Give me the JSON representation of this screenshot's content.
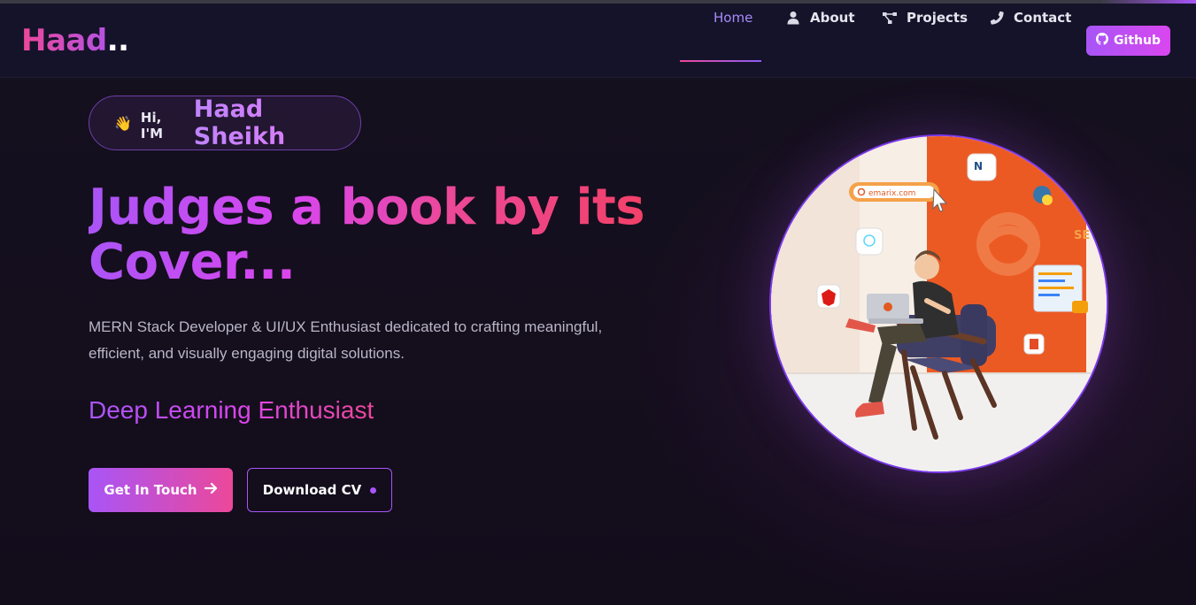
{
  "brand": {
    "name": "Haad",
    "dots": ".."
  },
  "nav": {
    "items": [
      {
        "label": "Home",
        "icon": "none",
        "active": true
      },
      {
        "label": "About",
        "icon": "user-icon"
      },
      {
        "label": "Projects",
        "icon": "project-icon"
      },
      {
        "label": "Contact",
        "icon": "phone-icon"
      }
    ],
    "github": {
      "label": "Github",
      "icon": "github-icon"
    }
  },
  "hero": {
    "greeting_wave": "👋",
    "greeting_prefix": "Hi, I'M",
    "name": "Haad Sheikh",
    "headline_line1": "Judges a book by its",
    "headline_line2": "Cover...",
    "description": "MERN Stack Developer & UI/UX Enthusiast dedicated to crafting meaningful, efficient, and visually engaging digital solutions.",
    "subtitle": "Deep Learning Enthusiast",
    "primary_button": "Get In Touch",
    "secondary_button": "Download CV"
  },
  "illustration": {
    "search_text": "emarix.com",
    "badge_se": "SE"
  },
  "colors": {
    "accent_purple": "#a855f7",
    "accent_pink": "#ec4899",
    "background": "#130e1f",
    "navbar": "#15132a",
    "orange_panel": "#ec5a24"
  }
}
